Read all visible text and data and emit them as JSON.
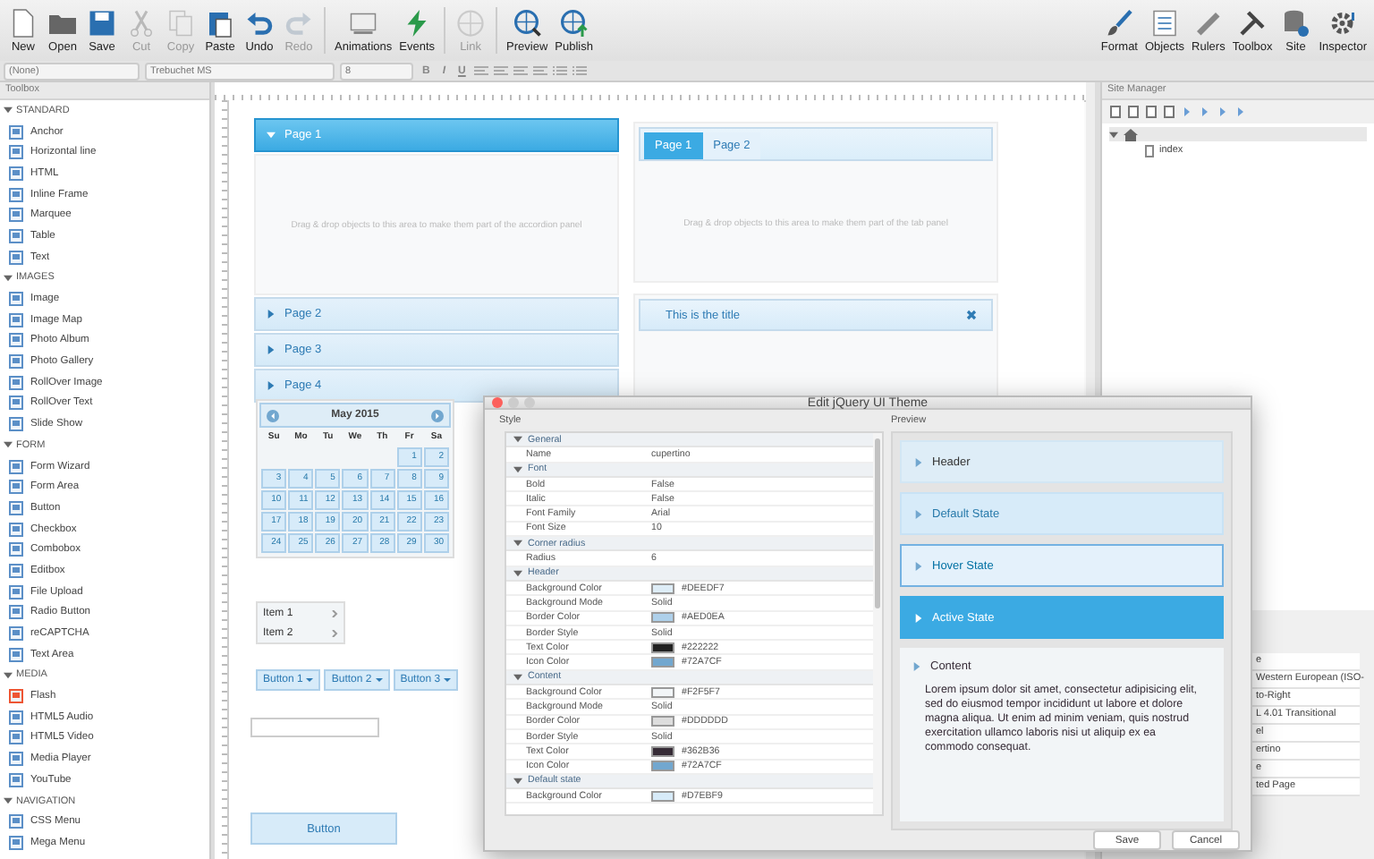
{
  "toolbar": {
    "left": [
      {
        "label": "New",
        "kind": "new",
        "disabled": false
      },
      {
        "label": "Open",
        "kind": "open",
        "disabled": false
      },
      {
        "label": "Save",
        "kind": "save",
        "disabled": false
      },
      {
        "label": "Cut",
        "kind": "cut",
        "disabled": true
      },
      {
        "label": "Copy",
        "kind": "copy",
        "disabled": true
      },
      {
        "label": "Paste",
        "kind": "paste",
        "disabled": false
      },
      {
        "label": "Undo",
        "kind": "undo",
        "disabled": false
      },
      {
        "label": "Redo",
        "kind": "redo",
        "disabled": true
      },
      {
        "label": "Animations",
        "kind": "animations",
        "disabled": false
      },
      {
        "label": "Events",
        "kind": "events",
        "disabled": false
      },
      {
        "label": "Link",
        "kind": "link",
        "disabled": true
      },
      {
        "label": "Preview",
        "kind": "preview",
        "disabled": false
      },
      {
        "label": "Publish",
        "kind": "publish",
        "disabled": false
      }
    ],
    "right": [
      {
        "label": "Format",
        "kind": "format",
        "disabled": false
      },
      {
        "label": "Objects",
        "kind": "objects",
        "disabled": false
      },
      {
        "label": "Rulers",
        "kind": "rulers",
        "disabled": false
      },
      {
        "label": "Toolbox",
        "kind": "toolbox",
        "disabled": false
      },
      {
        "label": "Site",
        "kind": "site",
        "disabled": false
      },
      {
        "label": "Inspector",
        "kind": "inspector",
        "disabled": false
      }
    ]
  },
  "format_bar": {
    "style_select": "(None)",
    "font_select": "Trebuchet MS",
    "size_select": "8",
    "text_buttons": [
      "B",
      "I",
      "U"
    ]
  },
  "toolbox": {
    "title": "Toolbox",
    "groups": [
      {
        "name": "STANDARD",
        "expanded": true,
        "items": [
          "Anchor",
          "Horizontal line",
          "HTML",
          "Inline Frame",
          "Marquee",
          "Table",
          "Text"
        ]
      },
      {
        "name": "IMAGES",
        "expanded": true,
        "items": [
          "Image",
          "Image Map",
          "Photo Album",
          "Photo Gallery",
          "RollOver Image",
          "RollOver Text",
          "Slide Show"
        ]
      },
      {
        "name": "FORM",
        "expanded": true,
        "items": [
          "Form Wizard",
          "Form Area",
          "Button",
          "Checkbox",
          "Combobox",
          "Editbox",
          "File Upload",
          "Radio Button",
          "reCAPTCHA",
          "Text Area"
        ]
      },
      {
        "name": "MEDIA",
        "expanded": true,
        "items": [
          "Flash",
          "HTML5 Audio",
          "HTML5 Video",
          "Media Player",
          "YouTube"
        ]
      },
      {
        "name": "NAVIGATION",
        "expanded": true,
        "items": [
          "CSS Menu",
          "Mega Menu"
        ]
      }
    ]
  },
  "canvas": {
    "accordion": {
      "pages": [
        {
          "label": "Page 1",
          "selected": true
        },
        {
          "label": "Page 2",
          "selected": false
        },
        {
          "label": "Page 3",
          "selected": false
        },
        {
          "label": "Page 4",
          "selected": false
        }
      ],
      "placeholder_text": "Drag & drop objects to this area to make them part of the accordion panel"
    },
    "tab_panel": {
      "tabs": [
        {
          "label": "Page 1",
          "selected": true
        },
        {
          "label": "Page 2",
          "selected": false
        }
      ],
      "placeholder_text": "Drag & drop objects to this area to make them part of the tab panel"
    },
    "title_panel": {
      "title": "This is the title"
    },
    "calendar": {
      "month": "May 2015",
      "weekdays": [
        "Su",
        "Mo",
        "Tu",
        "We",
        "Th",
        "Fr",
        "Sa"
      ],
      "weeks": [
        [
          "1",
          "2"
        ],
        [
          "3",
          "4",
          "5",
          "6",
          "7",
          "8",
          "9"
        ],
        [
          "10",
          "11",
          "12",
          "13",
          "14",
          "15",
          "16"
        ],
        [
          "17",
          "18",
          "19",
          "20",
          "21",
          "22",
          "23"
        ],
        [
          "24",
          "25",
          "26",
          "27",
          "28",
          "29",
          "30"
        ]
      ]
    },
    "menu": {
      "items": [
        "Item 1",
        "Item 2"
      ]
    },
    "dropdown_buttons": [
      "Button 1",
      "Button 2",
      "Button 3"
    ],
    "button": "Button"
  },
  "site_manager": {
    "title": "Site Manager",
    "tree": [
      {
        "expanded": true,
        "children": [
          {
            "label": "index"
          }
        ]
      }
    ]
  },
  "properties_panel": {
    "values": [
      "e",
      "Western European (ISO-",
      "to-Right",
      "L 4.01 Transitional",
      "el",
      "ertino",
      "e",
      "ted Page"
    ]
  },
  "dialog": {
    "title": "Edit jQuery UI Theme",
    "style_label": "Style",
    "groups": [
      {
        "name": "General",
        "expanded": true,
        "rows": [
          {
            "name": "Name",
            "value": "cupertino"
          }
        ]
      },
      {
        "name": "Font",
        "expanded": true,
        "rows": [
          {
            "name": "Bold",
            "value": "False"
          },
          {
            "name": "Italic",
            "value": "False"
          },
          {
            "name": "Font Family",
            "value": "Arial"
          },
          {
            "name": "Font Size",
            "value": "10"
          }
        ]
      },
      {
        "name": "Corner radius",
        "expanded": true,
        "rows": [
          {
            "name": "Radius",
            "value": "6"
          }
        ]
      },
      {
        "name": "Header",
        "expanded": true,
        "rows": [
          {
            "name": "Background Color",
            "value": "#DEEDF7",
            "color": "#deedf7"
          },
          {
            "name": "Background Mode",
            "value": "Solid"
          },
          {
            "name": "Border Color",
            "value": "#AED0EA",
            "color": "#aed0ea"
          },
          {
            "name": "Border Style",
            "value": "Solid"
          },
          {
            "name": "Text Color",
            "value": "#222222",
            "color": "#222222"
          },
          {
            "name": "Icon Color",
            "value": "#72A7CF",
            "color": "#72a7cf"
          }
        ]
      },
      {
        "name": "Content",
        "expanded": true,
        "rows": [
          {
            "name": "Background Color",
            "value": "#F2F5F7",
            "color": "#f2f5f7"
          },
          {
            "name": "Background Mode",
            "value": "Solid"
          },
          {
            "name": "Border Color",
            "value": "#DDDDDD",
            "color": "#dddddd"
          },
          {
            "name": "Border Style",
            "value": "Solid"
          },
          {
            "name": "Text Color",
            "value": "#362B36",
            "color": "#362b36"
          },
          {
            "name": "Icon Color",
            "value": "#72A7CF",
            "color": "#72a7cf"
          }
        ]
      },
      {
        "name": "Default state",
        "expanded": true,
        "rows": [
          {
            "name": "Background Color",
            "value": "#D7EBF9",
            "color": "#d7ebf9"
          }
        ]
      }
    ],
    "preview_label": "Preview",
    "preview_items": [
      {
        "label": "Header",
        "kind": "header"
      },
      {
        "label": "Default State",
        "kind": "default"
      },
      {
        "label": "Hover State",
        "kind": "hover"
      },
      {
        "label": "Active State",
        "kind": "active"
      },
      {
        "label": "Content",
        "kind": "content",
        "text": "Lorem ipsum dolor sit amet, consectetur adipisicing elit, sed do eiusmod tempor incididunt ut labore et dolore magna aliqua. Ut enim ad minim veniam, quis nostrud exercitation ullamco laboris nisi ut aliquip ex ea commodo consequat."
      }
    ],
    "buttons": [
      "Save",
      "Cancel"
    ]
  }
}
